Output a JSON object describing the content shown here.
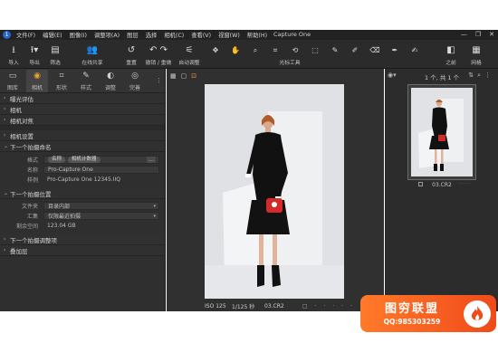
{
  "app": {
    "window_title": "Capture One",
    "logo_text": "1"
  },
  "menu": [
    "文件(F)",
    "编辑(E)",
    "图像(I)",
    "调整项(A)",
    "图层",
    "选择",
    "相机(C)",
    "查看(V)",
    "视窗(W)",
    "帮助(H)"
  ],
  "window_controls": [
    "—",
    "❐",
    "✕"
  ],
  "toolbar": {
    "import": "导入",
    "export": "导出",
    "filter": "筛选",
    "share": "在线共享",
    "reset": "重置",
    "undo_redo": "撤销 / 重做",
    "auto_adjust": "自动调整",
    "cursor_tools": "光标工具",
    "before_after": "之前",
    "grid": "网格"
  },
  "left_panel": {
    "tabs": [
      {
        "label": "图库",
        "icon": "folder-icon"
      },
      {
        "label": "相机",
        "icon": "camera-icon"
      },
      {
        "label": "形状",
        "icon": "crop-icon"
      },
      {
        "label": "样式",
        "icon": "palette-icon"
      },
      {
        "label": "调整",
        "icon": "sliders-icon"
      },
      {
        "label": "完善",
        "icon": "refine-icon"
      }
    ],
    "sections": {
      "exposure_eval": "曝光评估",
      "camera": "相机",
      "camera_focus": "相机对焦",
      "camera_settings": "相机设置",
      "next_capture_naming": "下一个拍摄命名",
      "next_capture_location": "下一个拍摄位置",
      "next_capture_adjustments": "下一个拍摄调整项",
      "overlay": "叠加层"
    },
    "naming": {
      "format_label": "格式",
      "format_chips": [
        "名称",
        "相机计数器"
      ],
      "name_label": "名称",
      "name_value": "Pro-Capture One",
      "sample_label": "样例",
      "sample_value": "Pro-Capture One 12345.IIQ"
    },
    "location": {
      "folder_label": "文件夹",
      "folder_value": "目录内部",
      "collection_label": "汇集",
      "collection_value": "仅限最近拍摄",
      "free_space_label": "剩余空间",
      "free_space_value": "123.04 GB"
    }
  },
  "viewer": {
    "iso": "ISO 125",
    "shutter": "1/125 秒",
    "filename": "03.CR2"
  },
  "browser": {
    "count": "1 个, 共 1 个",
    "thumb_name": "03.CR2"
  },
  "watermark": {
    "title": "图穷联盟",
    "qq": "QQ:985303259"
  },
  "colors": {
    "accent": "#f0a030",
    "watermark_orange": "#f04a1a",
    "panel_bg": "#2f2f2f"
  }
}
